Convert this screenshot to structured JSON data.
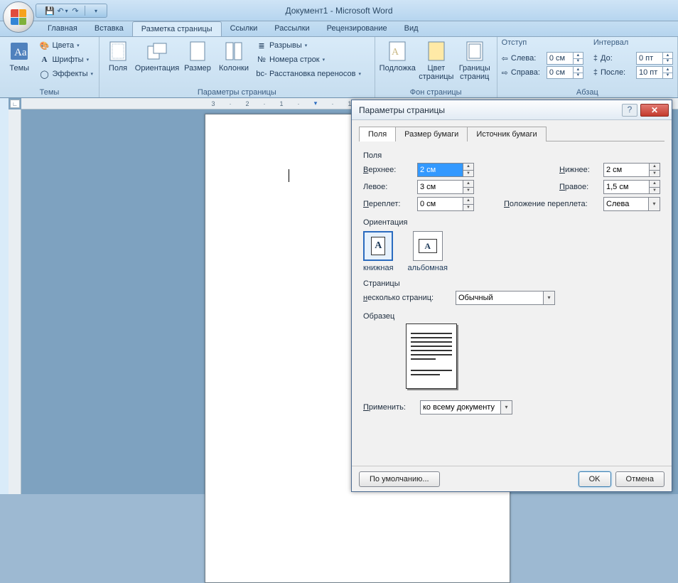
{
  "title": "Документ1 - Microsoft Word",
  "tabs": [
    "Главная",
    "Вставка",
    "Разметка страницы",
    "Ссылки",
    "Рассылки",
    "Рецензирование",
    "Вид"
  ],
  "ribbon": {
    "themes": {
      "main": "Темы",
      "colors": "Цвета",
      "fonts": "Шрифты",
      "effects": "Эффекты",
      "group": "Темы"
    },
    "page_setup": {
      "margins": "Поля",
      "orientation": "Ориентация",
      "size": "Размер",
      "columns": "Колонки",
      "breaks": "Разрывы",
      "line_numbers": "Номера строк",
      "hyphenation": "Расстановка переносов",
      "group": "Параметры страницы"
    },
    "bg": {
      "watermark": "Подложка",
      "page_color": "Цвет\nстраницы",
      "page_borders": "Границы\nстраниц",
      "group": "Фон страницы"
    },
    "indent": {
      "group_left": "Отступ",
      "left": "Слева:",
      "right": "Справа:",
      "left_v": "0 см",
      "right_v": "0 см",
      "group_right": "Интервал",
      "before": "До:",
      "after": "После:",
      "before_v": "0 пт",
      "after_v": "10 пт",
      "group": "Абзац"
    }
  },
  "dialog": {
    "title": "Параметры страницы",
    "tabs": [
      "Поля",
      "Размер бумаги",
      "Источник бумаги"
    ],
    "fields_label": "Поля",
    "top": "Верхнее:",
    "top_v": "2 см",
    "bottom": "Нижнее:",
    "bottom_v": "2 см",
    "left": "Левое:",
    "left_v": "3 см",
    "right": "Правое:",
    "right_v": "1,5 см",
    "gutter": "Переплет:",
    "gutter_v": "0 см",
    "gutter_pos": "Положение переплета:",
    "gutter_pos_v": "Слева",
    "orient_label": "Ориентация",
    "portrait": "книжная",
    "landscape": "альбомная",
    "pages_label": "Страницы",
    "multi": "несколько страниц:",
    "multi_v": "Обычный",
    "preview_label": "Образец",
    "apply": "Применить:",
    "apply_v": "ко всему документу",
    "default": "По умолчанию...",
    "ok": "OK",
    "cancel": "Отмена"
  }
}
